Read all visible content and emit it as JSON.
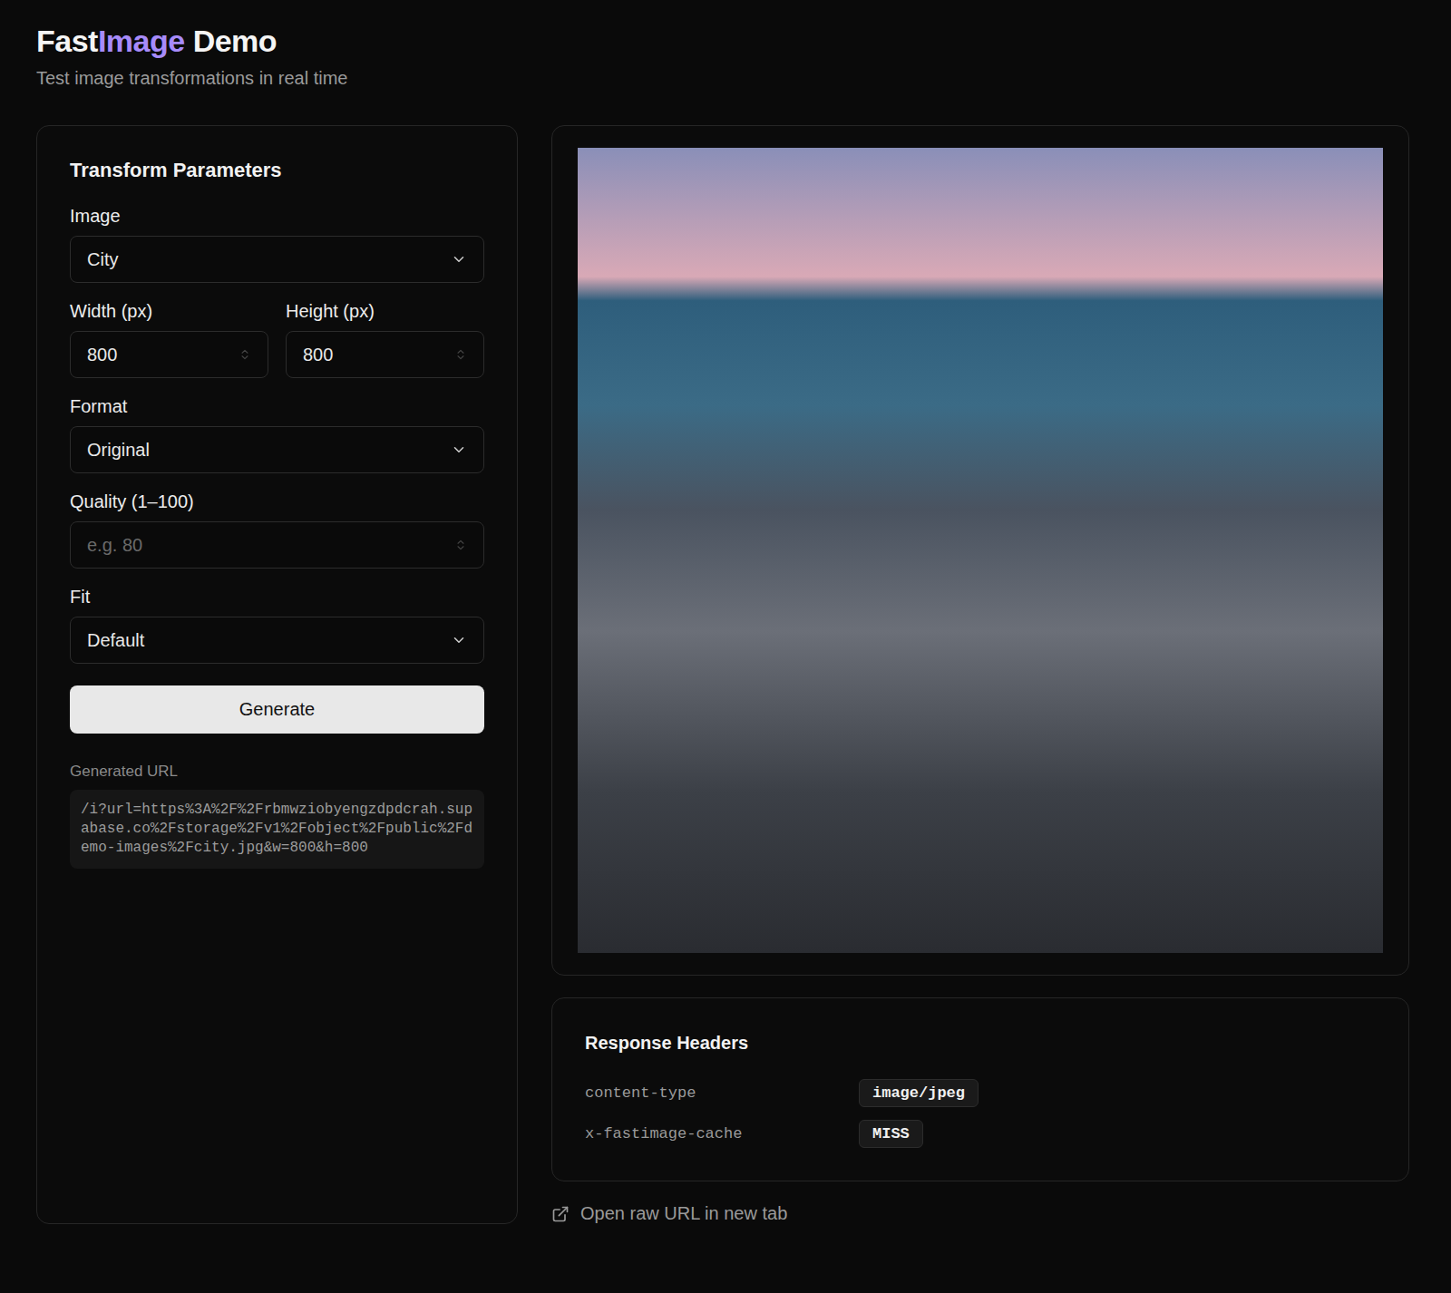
{
  "header": {
    "title_parts": [
      {
        "text": "Fast",
        "highlight": false
      },
      {
        "text": "Image",
        "highlight": true
      },
      {
        "text": " Demo",
        "highlight": false
      }
    ],
    "subtitle": "Test image transformations in real time"
  },
  "form": {
    "title": "Transform Parameters",
    "rows": [
      {
        "fields": [
          {
            "label": "Image",
            "kind": "select",
            "value": "City",
            "placeholder": ""
          }
        ]
      },
      {
        "fields": [
          {
            "label": "Width (px)",
            "kind": "number",
            "value": "800",
            "placeholder": ""
          },
          {
            "label": "Height (px)",
            "kind": "number",
            "value": "800",
            "placeholder": ""
          }
        ]
      },
      {
        "fields": [
          {
            "label": "Format",
            "kind": "select",
            "value": "Original",
            "placeholder": ""
          }
        ]
      },
      {
        "fields": [
          {
            "label": "Quality (1–100)",
            "kind": "number",
            "value": "",
            "placeholder": "e.g. 80"
          }
        ]
      },
      {
        "fields": [
          {
            "label": "Fit",
            "kind": "select",
            "value": "Default",
            "placeholder": ""
          }
        ]
      }
    ],
    "button": "Generate",
    "url_label": "Generated URL",
    "url": "/i?url=https%3A%2F%2Frbmwziobyengzdpdcrah.supabase.co%2Fstorage%2Fv1%2Fobject%2Fpublic%2Fdemo-images%2Fcity.jpg&w=800&h=800"
  },
  "headers": {
    "title": "Response Headers",
    "rows": [
      {
        "key": "content-type",
        "value": "image/jpeg"
      },
      {
        "key": "x-fastimage-cache",
        "value": "MISS"
      }
    ]
  },
  "link": "Open raw URL in new tab"
}
